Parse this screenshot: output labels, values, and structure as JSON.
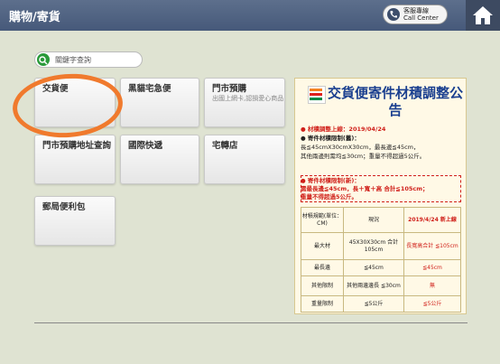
{
  "header": {
    "title": "購物/寄貨",
    "call_center": {
      "line1": "客服專線",
      "line2": "Call Center"
    }
  },
  "search": {
    "placeholder": "關鍵字查詢"
  },
  "tiles": [
    {
      "label": "交貨便",
      "sub": ""
    },
    {
      "label": "黑貓宅急便",
      "sub": ""
    },
    {
      "label": "門市預購",
      "sub": "出國上網卡,認損愛心商品"
    },
    {
      "label": "門市預購地址查詢",
      "sub": ""
    },
    {
      "label": "國際快遞",
      "sub": ""
    },
    {
      "label": "宅轉店",
      "sub": ""
    },
    {
      "label": "郵局便利包",
      "sub": ""
    }
  ],
  "poster": {
    "title": "交貨便寄件材積調整公告",
    "lines": [
      "● 材積調整上線：2019/04/24",
      "● 寄件材積限制(舊)：",
      "長≦45cmX30cmX30cm，最長邊≦45cm，",
      "其他兩邊則需均≦30cm；重量不得超過5公斤。",
      "● 寄件材積限制(新)：",
      "需最長邊≦45cm，長＋寬＋高 合計≦105cm；",
      "重量不得超過5公斤。"
    ],
    "table": {
      "header": [
        "材積規範(單位：CM)",
        "現況",
        "2019/4/24 新上線"
      ],
      "rows": [
        [
          "最大材",
          "45X30X30cm 合計105cm",
          "長寬高合計 ≦105cm"
        ],
        [
          "最長邊",
          "≦45cm",
          "≦45cm"
        ],
        [
          "其他限制",
          "其他兩邊邊長 ≦30cm",
          "無"
        ],
        [
          "重量限制",
          "≦5公斤",
          "≦5公斤"
        ]
      ]
    }
  }
}
